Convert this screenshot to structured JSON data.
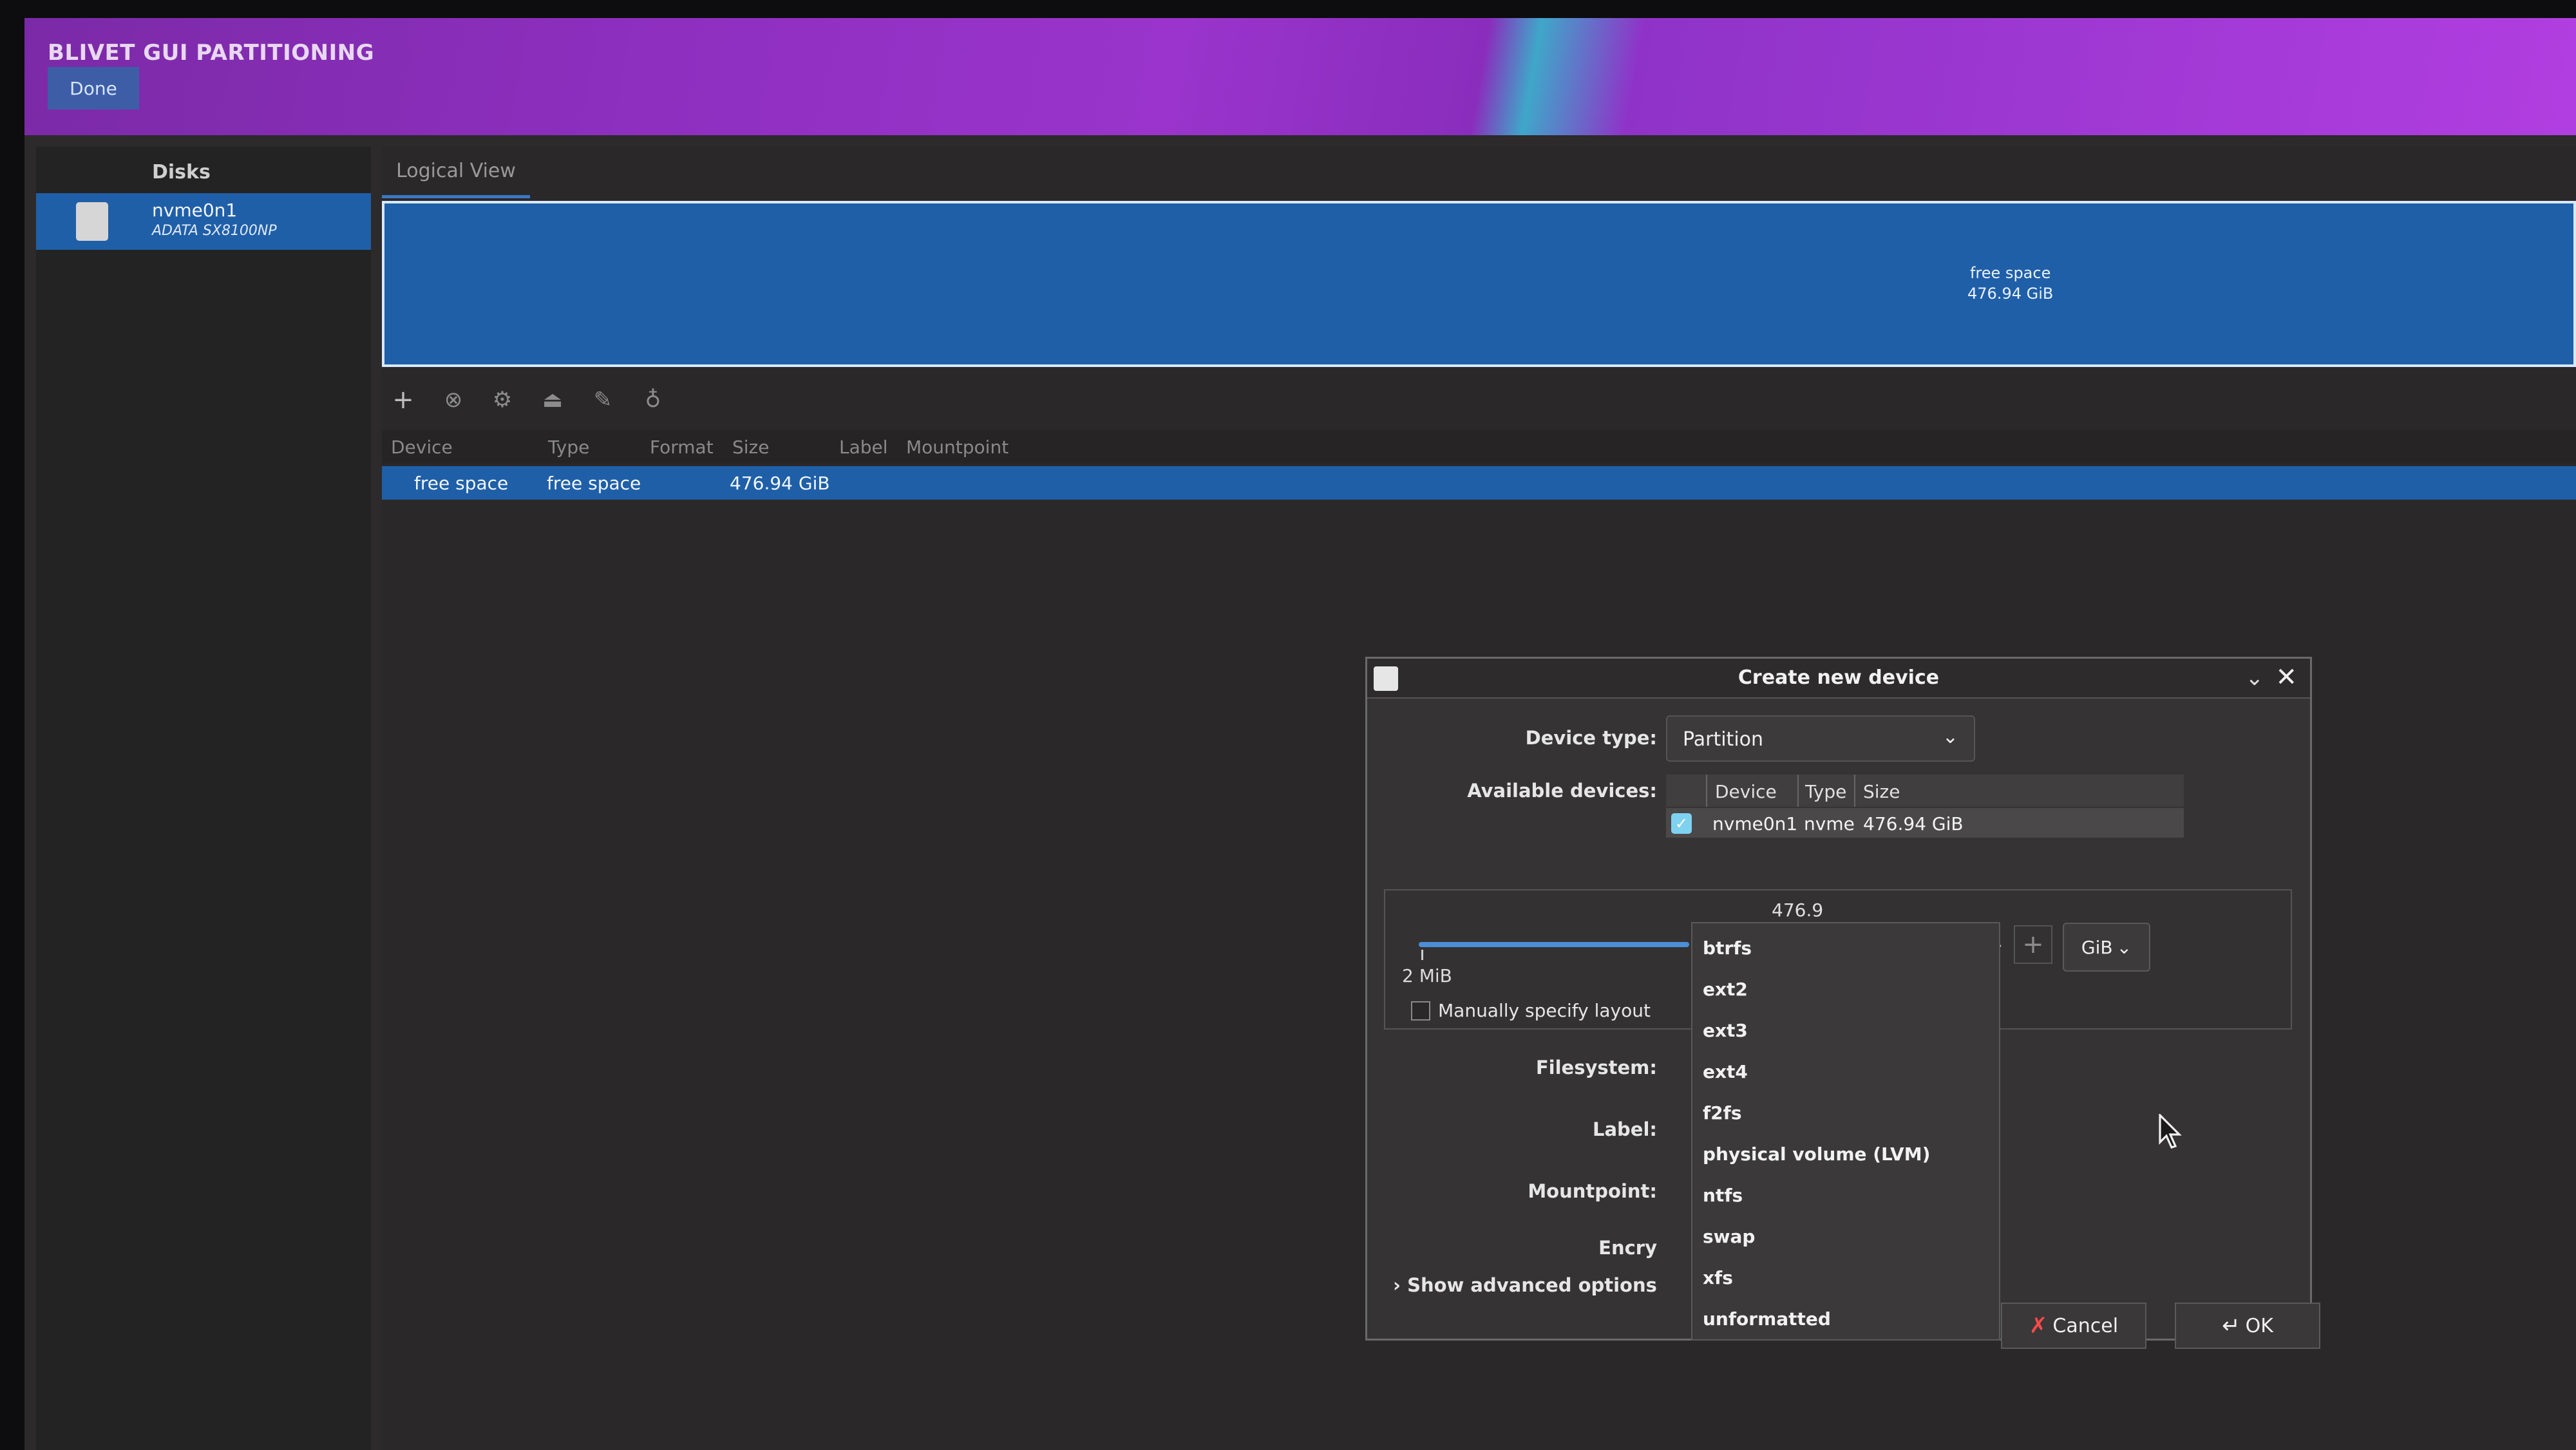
{
  "header": {
    "title": "BLIVET GUI PARTITIONING",
    "done_label": "Done"
  },
  "disks": {
    "title": "Disks",
    "items": [
      {
        "name": "nvme0n1",
        "model": "ADATA SX8100NP"
      }
    ]
  },
  "main": {
    "tab_label": "Logical View",
    "free_block": {
      "label": "free space",
      "size": "476.94 GiB"
    },
    "toolbar": {
      "icons": [
        "add-icon",
        "delete-icon",
        "settings-icon",
        "unmount-icon",
        "edit-icon",
        "info-icon"
      ]
    },
    "table": {
      "columns": [
        "Device",
        "Type",
        "Format",
        "Size",
        "Label",
        "Mountpoint"
      ],
      "rows": [
        {
          "device": "free space",
          "type": "free space",
          "format": "",
          "size": "476.94 GiB",
          "label": "",
          "mountpoint": ""
        }
      ]
    }
  },
  "dialog": {
    "title": "Create new device",
    "device_type_label": "Device type:",
    "device_type_value": "Partition",
    "available_label": "Available devices:",
    "available_columns": [
      "Device",
      "Type",
      "Size"
    ],
    "available_rows": [
      {
        "device": "nvme0n1",
        "type": "nvme",
        "size": "476.94 GiB"
      }
    ],
    "size": {
      "max_text": "476.9",
      "min_text": "2 MiB",
      "unit": "GiB"
    },
    "manual_label": "Manually specify layout",
    "filesystem_label": "Filesystem:",
    "label_label": "Label:",
    "mountpoint_label": "Mountpoint:",
    "encrypt_label": "Encry",
    "advanced_label": "Show advanced options",
    "cancel_label": "Cancel",
    "ok_label": "OK"
  },
  "filesystem_options": [
    "btrfs",
    "ext2",
    "ext3",
    "ext4",
    "f2fs",
    "physical volume (LVM)",
    "ntfs",
    "swap",
    "xfs",
    "unformatted"
  ]
}
